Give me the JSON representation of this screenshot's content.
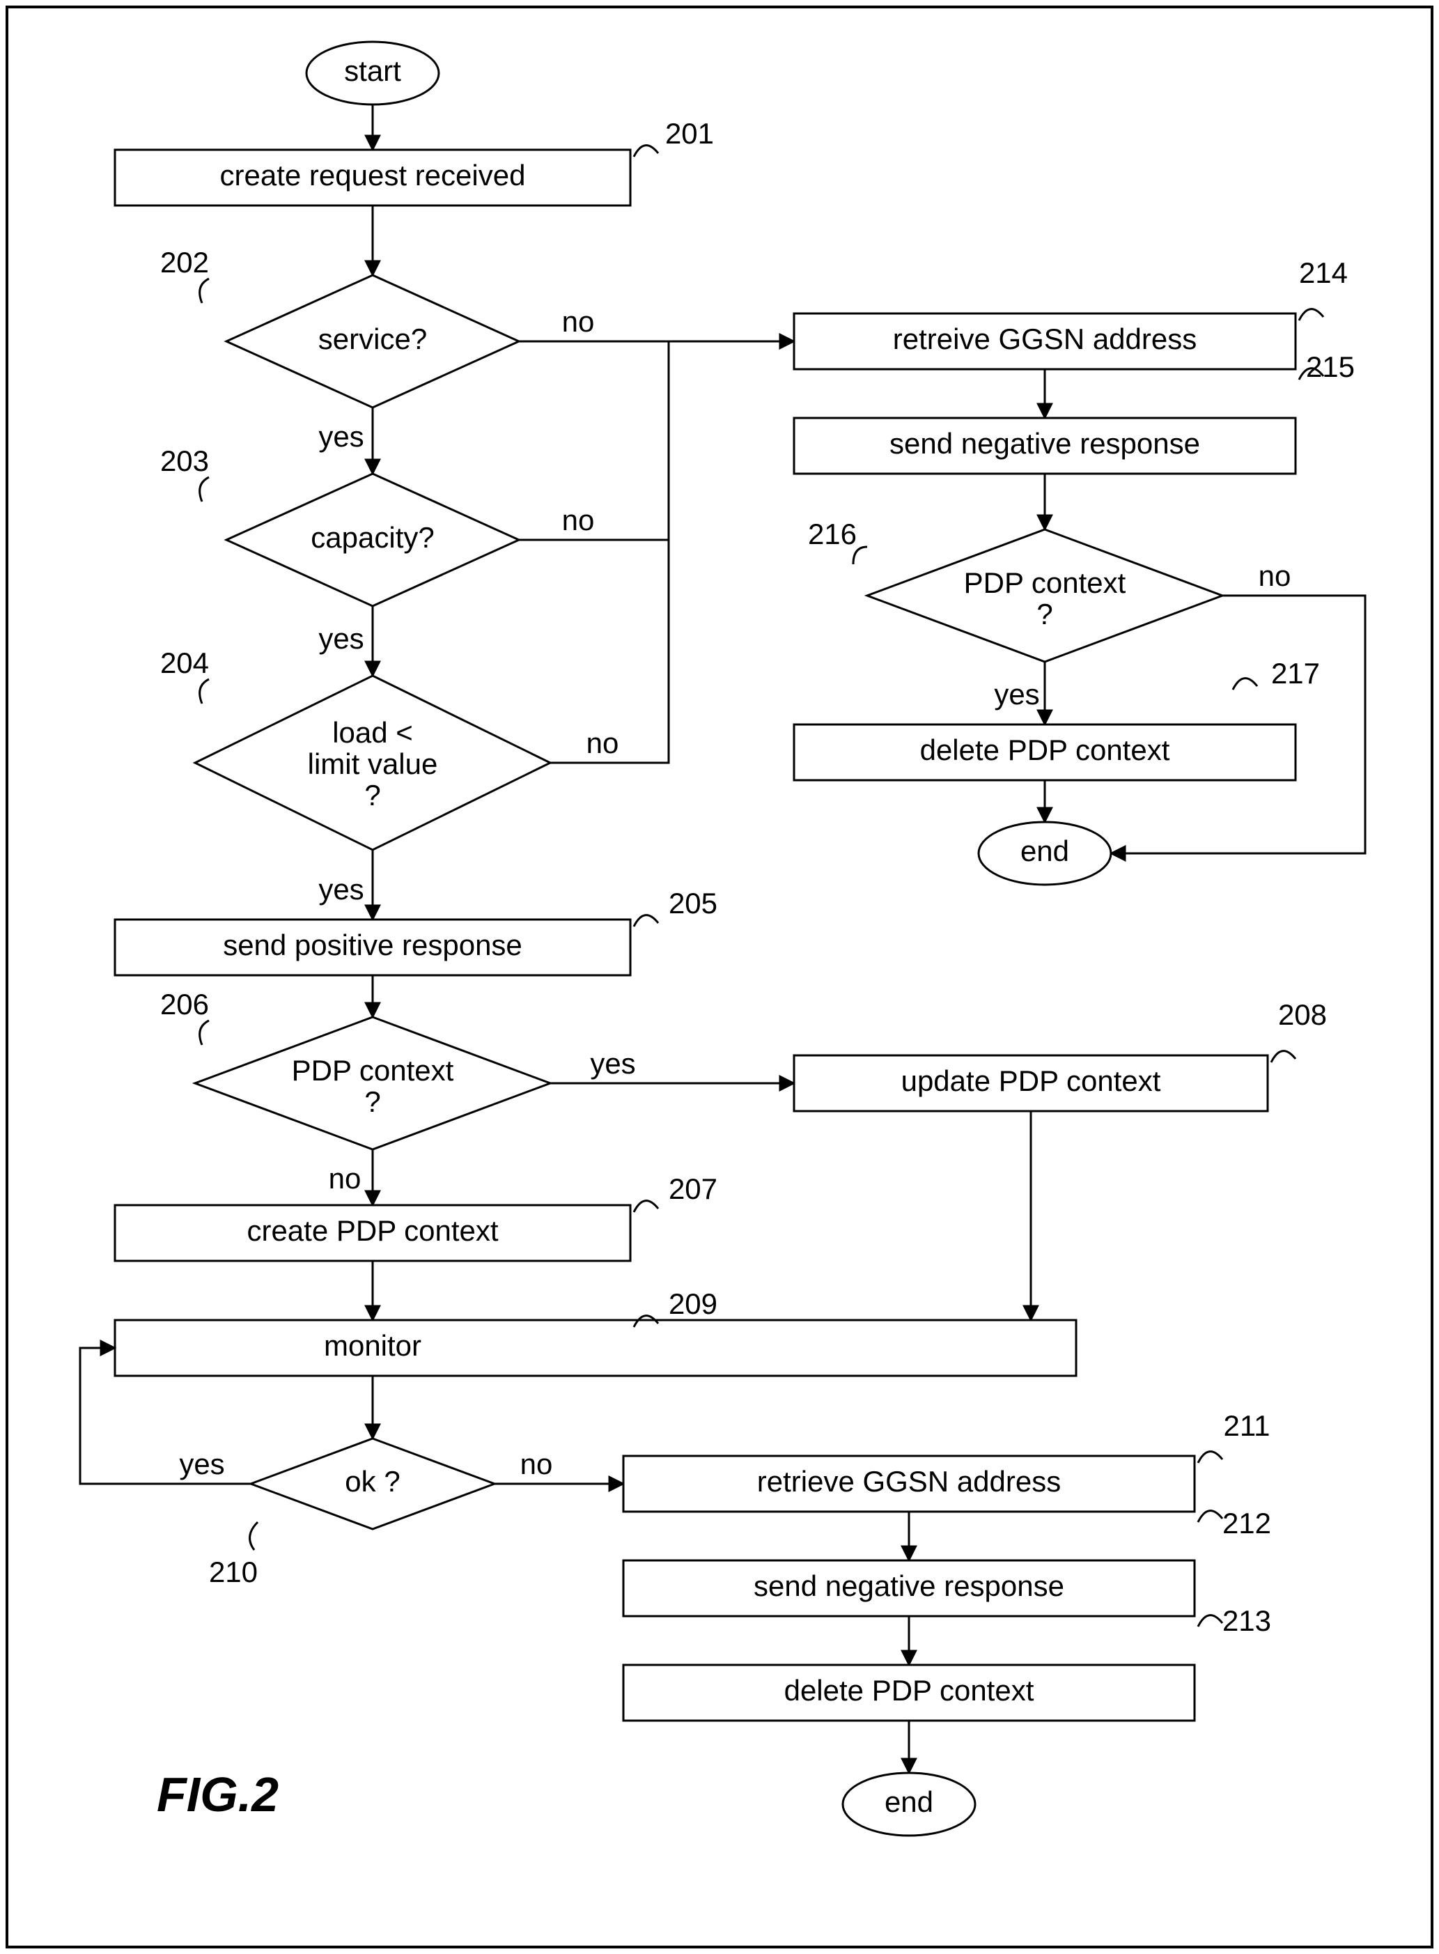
{
  "figure_label": "FIG.2",
  "terminals": {
    "start": "start",
    "end1": "end",
    "end2": "end"
  },
  "refs": {
    "r201": "201",
    "r202": "202",
    "r203": "203",
    "r204": "204",
    "r205": "205",
    "r206": "206",
    "r207": "207",
    "r208": "208",
    "r209": "209",
    "r210": "210",
    "r211": "211",
    "r212": "212",
    "r213": "213",
    "r214": "214",
    "r215": "215",
    "r216": "216",
    "r217": "217"
  },
  "steps": {
    "s201": "create request received",
    "s205": "send positive response",
    "s207": "create PDP context",
    "s208": "update PDP context",
    "s209": "monitor",
    "s211": "retrieve GGSN address",
    "s212": "send negative response",
    "s213": "delete PDP context",
    "s214": "retreive GGSN address",
    "s215": "send negative response",
    "s217": "delete PDP context"
  },
  "decisions": {
    "d202": "service?",
    "d203": "capacity?",
    "d204_l1": "load <",
    "d204_l2": "limit value",
    "d204_l3": "?",
    "d206_l1": "PDP context",
    "d206_l2": "?",
    "d210": "ok ?",
    "d216_l1": "PDP context",
    "d216_l2": "?"
  },
  "labels": {
    "yes": "yes",
    "no": "no"
  },
  "chart_data": {
    "type": "flowchart",
    "nodes": [
      {
        "id": "start",
        "type": "terminal",
        "text": "start"
      },
      {
        "id": "201",
        "type": "process",
        "text": "create request received"
      },
      {
        "id": "202",
        "type": "decision",
        "text": "service?"
      },
      {
        "id": "203",
        "type": "decision",
        "text": "capacity?"
      },
      {
        "id": "204",
        "type": "decision",
        "text": "load < limit value ?"
      },
      {
        "id": "205",
        "type": "process",
        "text": "send positive response"
      },
      {
        "id": "206",
        "type": "decision",
        "text": "PDP context ?"
      },
      {
        "id": "207",
        "type": "process",
        "text": "create PDP context"
      },
      {
        "id": "208",
        "type": "process",
        "text": "update PDP context"
      },
      {
        "id": "209",
        "type": "process",
        "text": "monitor"
      },
      {
        "id": "210",
        "type": "decision",
        "text": "ok ?"
      },
      {
        "id": "211",
        "type": "process",
        "text": "retrieve GGSN address"
      },
      {
        "id": "212",
        "type": "process",
        "text": "send negative response"
      },
      {
        "id": "213",
        "type": "process",
        "text": "delete PDP context"
      },
      {
        "id": "214",
        "type": "process",
        "text": "retreive GGSN address"
      },
      {
        "id": "215",
        "type": "process",
        "text": "send negative response"
      },
      {
        "id": "216",
        "type": "decision",
        "text": "PDP context ?"
      },
      {
        "id": "217",
        "type": "process",
        "text": "delete PDP context"
      },
      {
        "id": "end1",
        "type": "terminal",
        "text": "end"
      },
      {
        "id": "end2",
        "type": "terminal",
        "text": "end"
      }
    ],
    "edges": [
      {
        "from": "start",
        "to": "201"
      },
      {
        "from": "201",
        "to": "202"
      },
      {
        "from": "202",
        "to": "203",
        "label": "yes"
      },
      {
        "from": "202",
        "to": "214",
        "label": "no"
      },
      {
        "from": "203",
        "to": "204",
        "label": "yes"
      },
      {
        "from": "203",
        "to": "214",
        "label": "no"
      },
      {
        "from": "204",
        "to": "205",
        "label": "yes"
      },
      {
        "from": "204",
        "to": "214",
        "label": "no"
      },
      {
        "from": "205",
        "to": "206"
      },
      {
        "from": "206",
        "to": "207",
        "label": "no"
      },
      {
        "from": "206",
        "to": "208",
        "label": "yes"
      },
      {
        "from": "207",
        "to": "209"
      },
      {
        "from": "208",
        "to": "209"
      },
      {
        "from": "209",
        "to": "210"
      },
      {
        "from": "210",
        "to": "209",
        "label": "yes"
      },
      {
        "from": "210",
        "to": "211",
        "label": "no"
      },
      {
        "from": "211",
        "to": "212"
      },
      {
        "from": "212",
        "to": "213"
      },
      {
        "from": "213",
        "to": "end2"
      },
      {
        "from": "214",
        "to": "215"
      },
      {
        "from": "215",
        "to": "216"
      },
      {
        "from": "216",
        "to": "217",
        "label": "yes"
      },
      {
        "from": "216",
        "to": "end1",
        "label": "no"
      },
      {
        "from": "217",
        "to": "end1"
      }
    ]
  }
}
